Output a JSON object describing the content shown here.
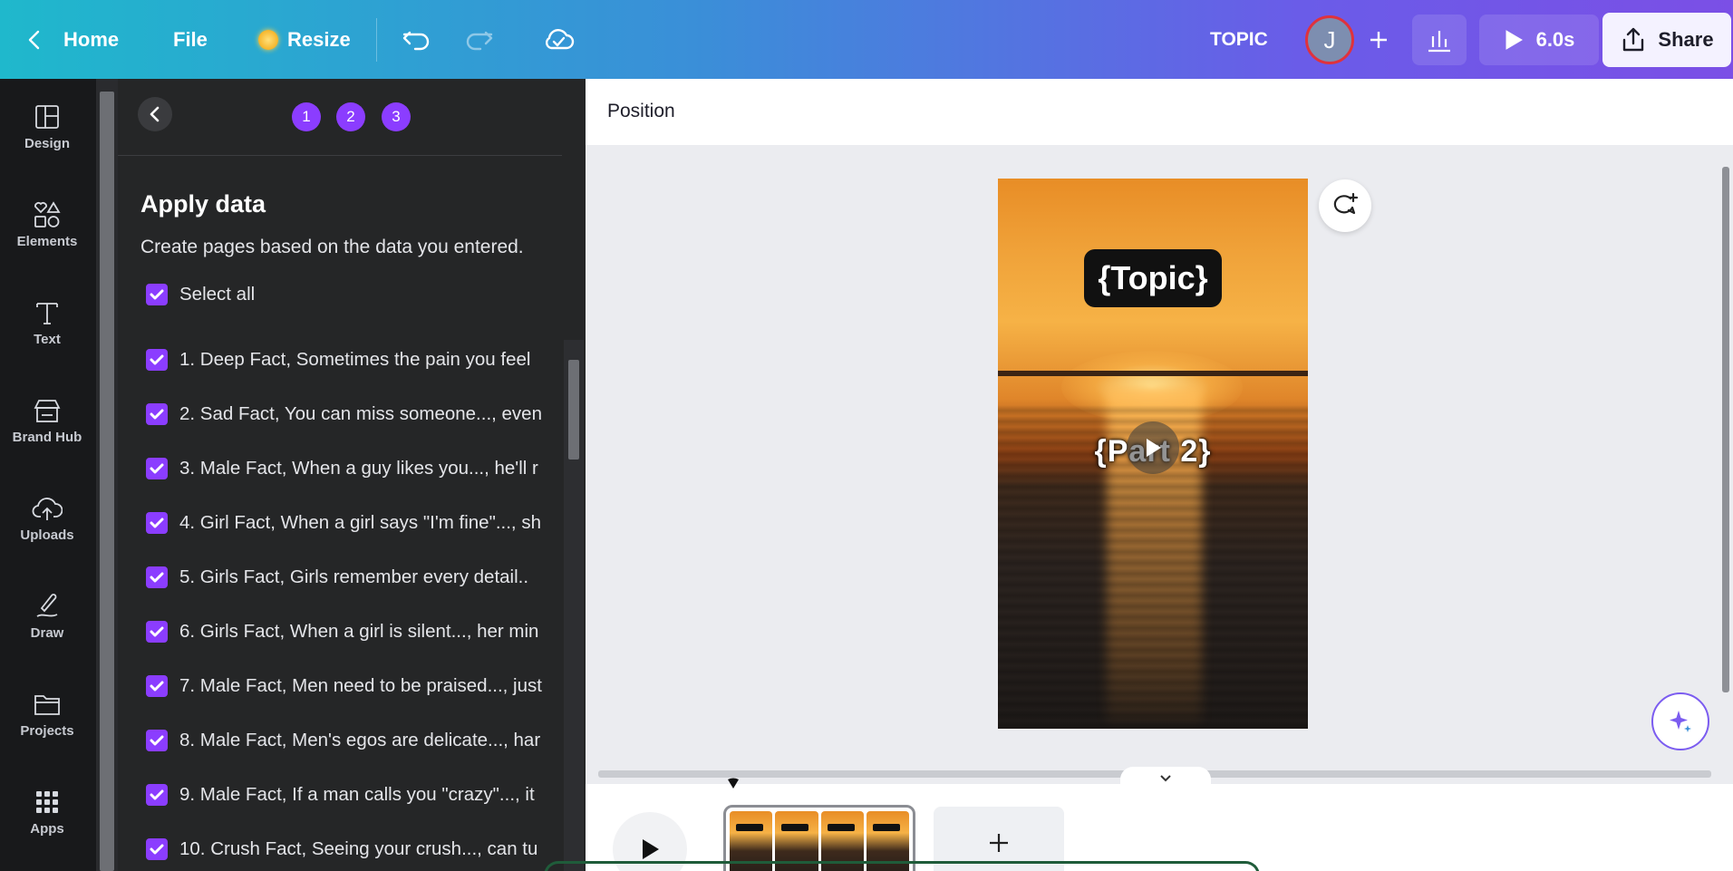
{
  "topbar": {
    "home_label": "Home",
    "file_label": "File",
    "resize_label": "Resize",
    "doc_title": "TOPIC",
    "avatar_initial": "J",
    "duration": "6.0s",
    "share_label": "Share"
  },
  "rail": {
    "items": [
      {
        "label": "Design",
        "icon": "design-icon"
      },
      {
        "label": "Elements",
        "icon": "elements-icon"
      },
      {
        "label": "Text",
        "icon": "text-icon"
      },
      {
        "label": "Brand Hub",
        "icon": "brand-hub-icon"
      },
      {
        "label": "Uploads",
        "icon": "uploads-icon"
      },
      {
        "label": "Draw",
        "icon": "draw-icon"
      },
      {
        "label": "Projects",
        "icon": "projects-icon"
      },
      {
        "label": "Apps",
        "icon": "apps-icon"
      }
    ]
  },
  "panel": {
    "steps": [
      "1",
      "2",
      "3"
    ],
    "title": "Apply data",
    "subtitle": "Create pages based on the data you entered.",
    "select_all": "Select all",
    "rows": [
      "1. Deep Fact, Sometimes the pain you feel",
      "2. Sad Fact, You can miss someone..., even",
      "3. Male Fact, When a guy likes you..., he'll r",
      "4. Girl Fact, When a girl says \"I'm fine\"..., sh",
      "5. Girls Fact, Girls remember every detail..",
      "6. Girls Fact, When a girl is silent..., her min",
      "7. Male Fact, Men need to be praised..., just",
      "8. Male Fact, Men's egos are delicate..., har",
      "9. Male Fact, If a man calls you \"crazy\"..., it",
      "10. Crush Fact, Seeing your crush..., can tu"
    ]
  },
  "canvas": {
    "position_label": "Position",
    "topic_text": "{Topic}",
    "part_text": "{Part 2}"
  },
  "colors": {
    "accent": "#8b3dff",
    "topbar_start": "#1fb8cc",
    "topbar_end": "#7b4fe6",
    "panel_bg": "#252627",
    "rail_bg": "#18191b"
  }
}
